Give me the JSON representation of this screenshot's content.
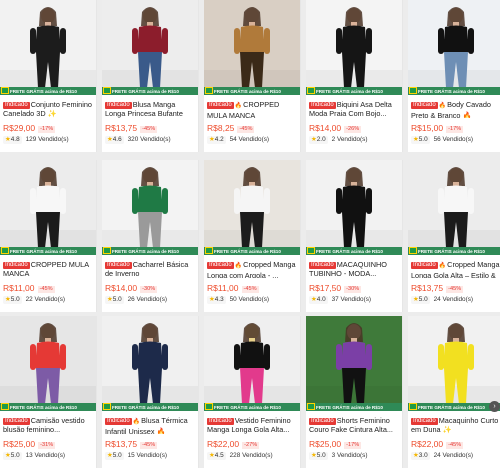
{
  "shipping_banner": "FRETE GRÁTIS acima de R$10",
  "badge_label": "Indicado",
  "products": [
    {
      "emoji": "✨",
      "name": "Conjunto Feminino Canelado 3D ✨",
      "price": "R$29,00",
      "discount": "-17%",
      "rating": "4.8",
      "sold": "129 Vendido(s)",
      "indicado": true,
      "fire": false,
      "palette": [
        "#f2f2f2",
        "#1c1c1c",
        "#1c1c1c",
        "#d9b29c"
      ]
    },
    {
      "emoji": "✨",
      "name": "Blusa Manga Longa Princesa Bufante Lanzinha",
      "price": "R$13,75",
      "discount": "-45%",
      "rating": "4.6",
      "sold": "320 Vendido(s)",
      "indicado": true,
      "fire": false,
      "palette": [
        "#ededed",
        "#8c1d2c",
        "#3a5a8a",
        "#d8b299"
      ]
    },
    {
      "emoji": "🔥",
      "name": "CROPPED MULA MANCA",
      "price": "R$8,25",
      "discount": "-45%",
      "rating": "4.2",
      "sold": "54 Vendido(s)",
      "indicado": true,
      "fire": true,
      "palette": [
        "#d9cfc4",
        "#b07a3a",
        "#3b2a18",
        "#d8b299"
      ]
    },
    {
      "emoji": "",
      "name": "Biquini Asa Delta Moda Praia Com Bojo...",
      "price": "R$14,00",
      "discount": "-26%",
      "rating": "2.0",
      "sold": "2 Vendido(s)",
      "indicado": true,
      "fire": false,
      "palette": [
        "#f4f4f4",
        "#151515",
        "#151515",
        "#dcb39a"
      ]
    },
    {
      "emoji": "🔥",
      "name": "Body Cavado Preto & Branco 🔥",
      "price": "R$15,00",
      "discount": "-17%",
      "rating": "5.0",
      "sold": "56 Vendido(s)",
      "indicado": true,
      "fire": true,
      "palette": [
        "#eef1f4",
        "#111111",
        "#6e8fb5",
        "#d8b299"
      ]
    },
    {
      "emoji": "✨",
      "name": "CROPPED MULA MANCA",
      "price": "R$11,00",
      "discount": "-45%",
      "rating": "5.0",
      "sold": "22 Vendido(s)",
      "indicado": true,
      "fire": false,
      "palette": [
        "#ececec",
        "#f7f7f7",
        "#1b1b1b",
        "#d8b299"
      ]
    },
    {
      "emoji": "✨",
      "name": "Cacharrel Básica de Inverno",
      "price": "R$14,00",
      "discount": "-30%",
      "rating": "5.0",
      "sold": "26 Vendido(s)",
      "indicado": true,
      "fire": false,
      "palette": [
        "#f3f3f3",
        "#1f7a45",
        "#9a9a9a",
        "#d8b299"
      ]
    },
    {
      "emoji": "🔥",
      "name": "Cropped Manga Longa com Argola - ...",
      "price": "R$11,00",
      "discount": "-45%",
      "rating": "4.3",
      "sold": "50 Vendido(s)",
      "indicado": true,
      "fire": true,
      "palette": [
        "#e8e4de",
        "#f5f5f5",
        "#1c1c1c",
        "#d8b299"
      ]
    },
    {
      "emoji": "✨",
      "name": "MACAQUINHO TUBINHO - MODA...",
      "price": "R$17,50",
      "discount": "-30%",
      "rating": "4.0",
      "sold": "37 Vendido(s)",
      "indicado": true,
      "fire": false,
      "palette": [
        "#f2f2f2",
        "#111111",
        "#111111",
        "#d8b299"
      ]
    },
    {
      "emoji": "🔥",
      "name": "Cropped Manga Longa Gola Alta – Estilo & ...",
      "price": "R$13,75",
      "discount": "-45%",
      "rating": "5.0",
      "sold": "24 Vendido(s)",
      "indicado": true,
      "fire": true,
      "palette": [
        "#ececec",
        "#f7f7f7",
        "#1b1b1b",
        "#d8b299"
      ]
    },
    {
      "emoji": "",
      "name": "Camisão vestido blusão feminino...",
      "price": "R$25,00",
      "discount": "-31%",
      "rating": "5.0",
      "sold": "13 Vendido(s)",
      "indicado": true,
      "fire": false,
      "palette": [
        "#e6e6e6",
        "#e53935",
        "#7d5ba6",
        "#d8b299"
      ]
    },
    {
      "emoji": "🔥",
      "name": "Blusa Térmica Infantil Unissex 🔥",
      "price": "R$13,75",
      "discount": "-45%",
      "rating": "5.0",
      "sold": "15 Vendido(s)",
      "indicado": true,
      "fire": true,
      "palette": [
        "#f0f0f0",
        "#1d2a4a",
        "#1d2a4a",
        "#d8b299"
      ]
    },
    {
      "emoji": "",
      "name": "Vestido Feminino Manga Longa Gola Alta...",
      "price": "R$22,00",
      "discount": "-27%",
      "rating": "4.5",
      "sold": "228 Vendido(s)",
      "indicado": true,
      "fire": false,
      "palette": [
        "#efefef",
        "#111111",
        "#e23a8c",
        "#e8d08a"
      ]
    },
    {
      "emoji": "",
      "name": "Shorts Feminino Couro Fake Cintura Alta...",
      "price": "R$25,00",
      "discount": "-17%",
      "rating": "5.0",
      "sold": "3 Vendido(s)",
      "indicado": true,
      "fire": false,
      "palette": [
        "#3f7a3a",
        "#7b3fa6",
        "#111111",
        "#d8b299"
      ]
    },
    {
      "emoji": "✨",
      "name": "Macaquinho Curto em Duna ✨",
      "price": "R$22,00",
      "discount": "-45%",
      "rating": "3.0",
      "sold": "24 Vendido(s)",
      "indicado": true,
      "fire": false,
      "palette": [
        "#f1f1f1",
        "#f2e020",
        "#f2e020",
        "#d8b299"
      ]
    }
  ],
  "next_arrow": "›"
}
